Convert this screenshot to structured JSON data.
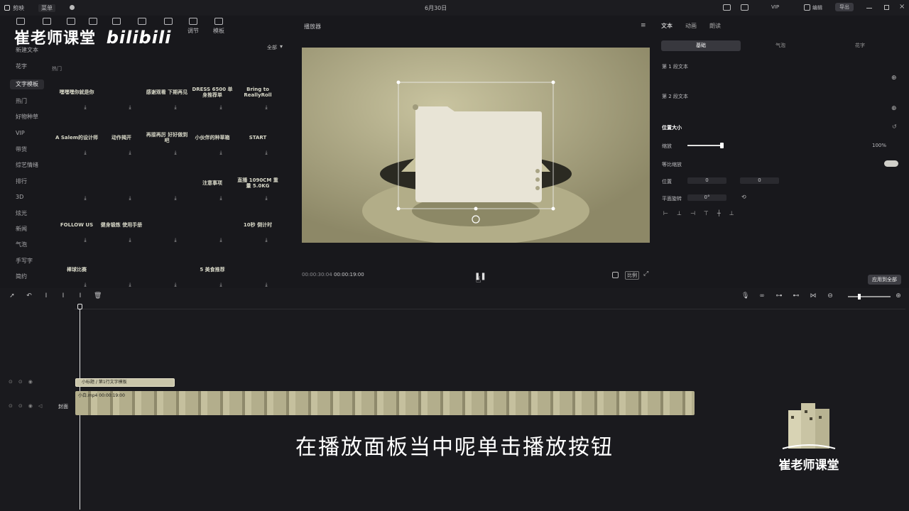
{
  "titlebar": {
    "app_name": "剪映",
    "menu": "菜单",
    "date": "6月30日",
    "right_label_1": "编辑",
    "right_label_2": "导出"
  },
  "toolbar": {
    "watermark_text": "崔老师课堂",
    "watermark_brand": "bilibili",
    "tools": [
      {
        "label": "调节",
        "icon": "adjust-icon"
      },
      {
        "label": "模板",
        "icon": "template-icon"
      }
    ]
  },
  "sidebar": {
    "new_text": "新建文本",
    "items": [
      "花字",
      "文字模板",
      "热门",
      "好物种草",
      "VIP",
      "带货",
      "综艺情绪",
      "排行",
      "3D",
      "炫光",
      "新闻",
      "气泡",
      "手写字",
      "简约"
    ],
    "selected_index": 1
  },
  "library": {
    "filter_all": "全部",
    "section_label": "热门",
    "cards": [
      [
        "嘿嘿嘿你就是你",
        "",
        "感谢观看 下期再见",
        "DRESS 6500 单身推荐单",
        "Bring to ReallyRoll"
      ],
      [
        "A Salem的设计师",
        "动作揭开",
        "再接再厉 好好做到吧",
        "小伙伴的种草箱",
        "START"
      ],
      [
        "",
        "",
        "",
        "注意事项",
        "直播 1090CM 重量 5.0KG"
      ],
      [
        "FOLLOW US",
        "健身锻炼 使用手册",
        "",
        "",
        "10秒 倒计时"
      ],
      [
        "棒球比赛",
        "",
        "",
        "5 美食推荐",
        ""
      ]
    ]
  },
  "player": {
    "title": "播放器",
    "time_current": "00:00:30:04",
    "time_total": "00:00:19:00",
    "ratio_label": "比例"
  },
  "properties": {
    "tabs": [
      "文本",
      "动画",
      "朗读"
    ],
    "subtabs": [
      "基础",
      "气泡",
      "花字"
    ],
    "text1_label": "第 1 段文本",
    "text2_label": "第 2 段文本",
    "position_size": "位置大小",
    "scale_label": "缩放",
    "scale_value": "100%",
    "uniform_scale": "等比缩放",
    "position_label": "位置",
    "pos_x": "0",
    "pos_y": "0",
    "rotate_label": "平面旋转",
    "rotate_value": "0°",
    "apply_button": "应用到全部"
  },
  "timeline": {
    "text_clip_label": "小标题 / 第1行文字模板",
    "video_clip_label": "小白.mp4  00:00:19:00",
    "cover_label": "封面"
  },
  "overlay": {
    "caption": "在播放面板当中呢单击播放按钮",
    "logo_text": "崔老师课堂"
  }
}
